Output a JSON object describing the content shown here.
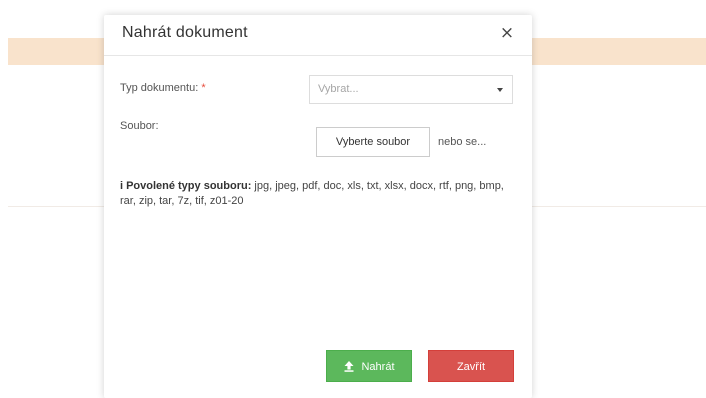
{
  "modal": {
    "title": "Nahrát dokument",
    "close_symbol": "×",
    "close_icon": "close-icon"
  },
  "form": {
    "document_type_label": "Typ dokumentu:",
    "required_mark": "*",
    "document_type_value": "Vybrat...",
    "file_label": "Soubor:",
    "file_button_label": "Vyberte soubor",
    "drop_hint": "nebo se..."
  },
  "allowed": {
    "icon_symbol": "i",
    "label": "Povolené typy souboru:",
    "types": "jpg, jpeg, pdf, doc, xls, txt, xlsx, docx, rtf, png, bmp, rar, zip, tar, 7z, tif, z01-20"
  },
  "buttons": {
    "upload_label": "Nahrát",
    "upload_icon": "upload-icon",
    "close_label": "Zavřít"
  },
  "colors": {
    "background_band": "#f9e3cc",
    "upload": "#5cb85c",
    "close": "#d9534f",
    "required": "#e74c3c"
  }
}
